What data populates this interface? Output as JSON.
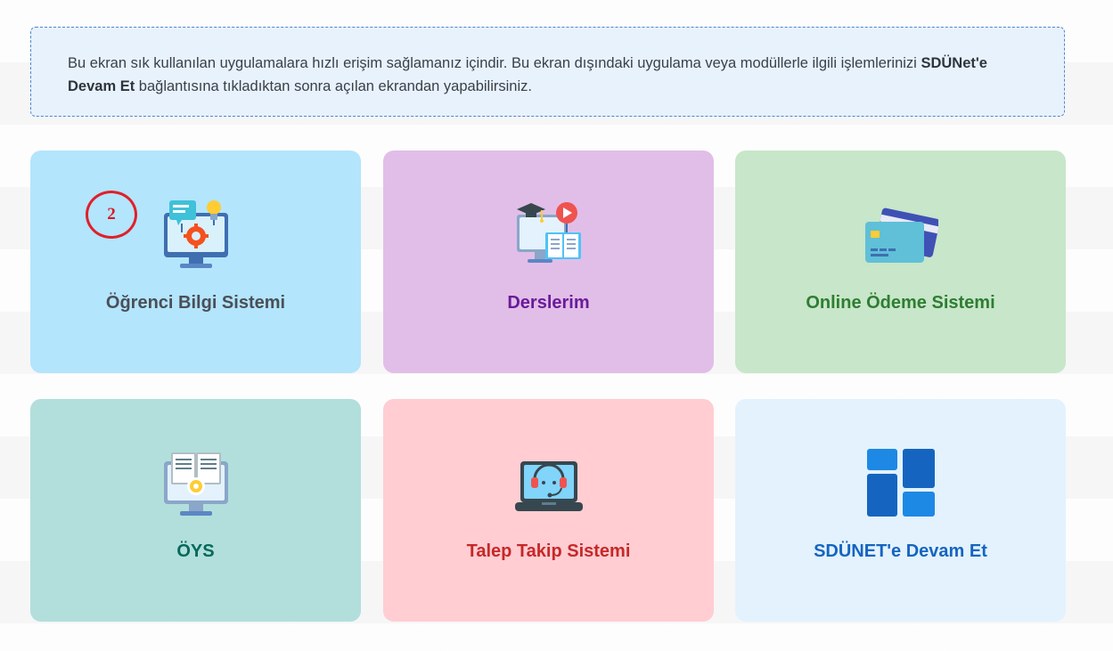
{
  "info": {
    "text_before": "Bu ekran sık kullanılan uygulamalara hızlı erişim sağlamanız içindir. Bu ekran dışındaki uygulama veya modüllerle ilgili işlemlerinizi ",
    "bold_link": "SDÜNet'e Devam Et",
    "text_after": " bağlantısına tıkladıktan sonra açılan ekrandan yapabilirsiniz."
  },
  "cards": [
    {
      "label": "Öğrenci Bilgi Sistemi",
      "icon": "computer-settings-icon",
      "bg": "#b3e5fc",
      "color": "#4a4f57"
    },
    {
      "label": "Derslerim",
      "icon": "online-course-icon",
      "bg": "#e1bee7",
      "color": "#6a1b9a"
    },
    {
      "label": "Online Ödeme Sistemi",
      "icon": "credit-card-icon",
      "bg": "#c8e6c9",
      "color": "#2e7d32"
    },
    {
      "label": "ÖYS",
      "icon": "ebook-monitor-icon",
      "bg": "#b2dfdb",
      "color": "#00695c"
    },
    {
      "label": "Talep Takip Sistemi",
      "icon": "support-laptop-icon",
      "bg": "#ffcdd2",
      "color": "#c62828"
    },
    {
      "label": "SDÜNET'e Devam Et",
      "icon": "dashboard-tiles-icon",
      "bg": "#e3f2fd",
      "color": "#1565c0"
    }
  ],
  "annotation": {
    "number": "2"
  }
}
